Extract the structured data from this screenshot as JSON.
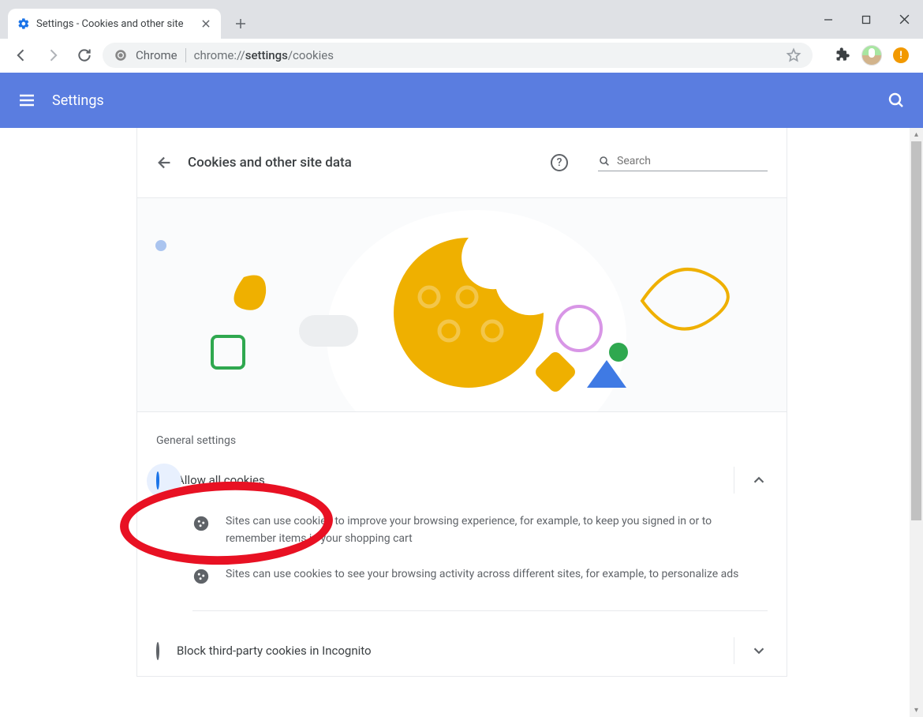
{
  "tab": {
    "title": "Settings - Cookies and other site"
  },
  "omnibox": {
    "chrome_label": "Chrome",
    "url_prefix": "chrome://",
    "url_bold": "settings",
    "url_suffix": "/cookies"
  },
  "header": {
    "title": "Settings"
  },
  "page": {
    "title": "Cookies and other site data",
    "search_placeholder": "Search",
    "section_label": "General settings",
    "options": [
      {
        "label": "Allow all cookies",
        "selected": true,
        "expanded": true,
        "details": [
          "Sites can use cookies to improve your browsing experience, for example, to keep you signed in or to remember items in your shopping cart",
          "Sites can use cookies to see your browsing activity across different sites, for example, to personalize ads"
        ]
      },
      {
        "label": "Block third-party cookies in Incognito",
        "selected": false,
        "expanded": false
      }
    ]
  }
}
